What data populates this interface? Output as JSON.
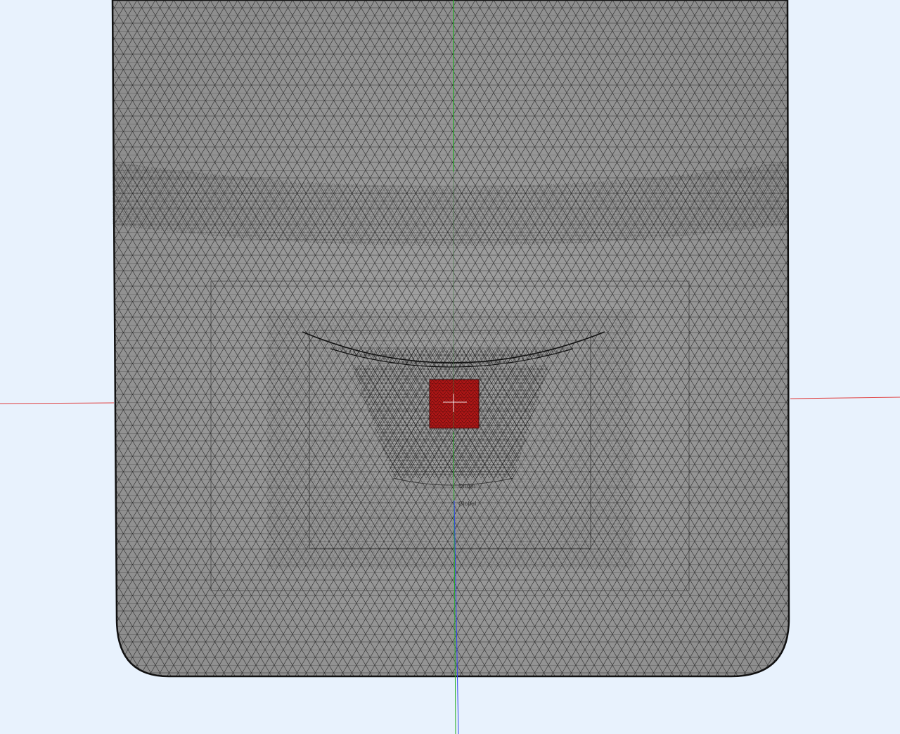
{
  "viewport": {
    "background": "#e8f2fd",
    "mesh_fill": "#9a9a9a",
    "mesh_line": "#1a1a1a",
    "highlight_fill": "#b01616"
  },
  "axes": {
    "x_color": "#e04040",
    "y_color": "#22aa22",
    "z_color": "#3344ee"
  },
  "labels": {
    "origin_label_1": "Origin",
    "origin_label_2": "Global"
  }
}
